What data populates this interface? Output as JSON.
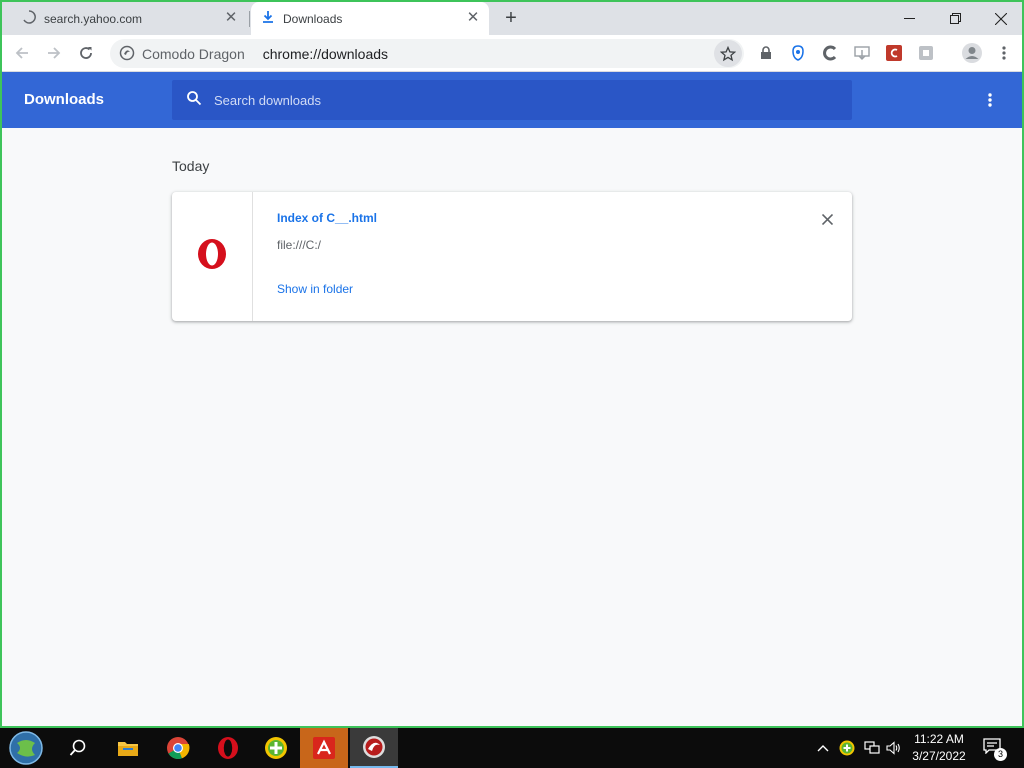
{
  "browser": {
    "tabs": [
      {
        "label": "search.yahoo.com",
        "icon": "loading-spinner-icon"
      },
      {
        "label": "Downloads",
        "icon": "download-icon",
        "active": true
      }
    ],
    "omnibox": {
      "brand": "Comodo Dragon",
      "url": "chrome://downloads"
    }
  },
  "downloads": {
    "title": "Downloads",
    "search_placeholder": "Search downloads",
    "section_label": "Today",
    "items": [
      {
        "file_name": "Index of C__.html",
        "url": "file:///C:/",
        "action": "Show in folder",
        "icon": "opera-icon"
      }
    ]
  },
  "taskbar": {
    "apps": [
      "start-icon",
      "search-icon",
      "file-explorer-icon",
      "chrome-icon",
      "opera-icon",
      "plus-app-icon",
      "avira-icon",
      "comodo-dragon-icon"
    ],
    "time": "11:22 AM",
    "date": "3/27/2022",
    "notification_count": "3"
  },
  "colors": {
    "accent": "#3367d6",
    "link": "#1a73e8",
    "window_border": "#3ec45a"
  }
}
